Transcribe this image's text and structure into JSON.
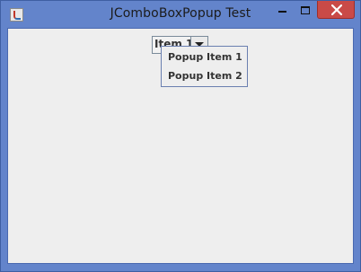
{
  "window": {
    "title": "JComboBoxPopup Test"
  },
  "combo": {
    "selected": "Item 1"
  },
  "popup": {
    "items": [
      {
        "label": "Popup Item 1"
      },
      {
        "label": "Popup Item 2"
      }
    ]
  },
  "icons": {
    "app": "java-app-icon",
    "minimize": "minimize-icon",
    "maximize": "maximize-icon",
    "close": "close-icon",
    "dropdown": "chevron-down-icon"
  },
  "colors": {
    "frame": "#6384cb",
    "content_bg": "#eeeeee",
    "close_button": "#c94a47"
  }
}
